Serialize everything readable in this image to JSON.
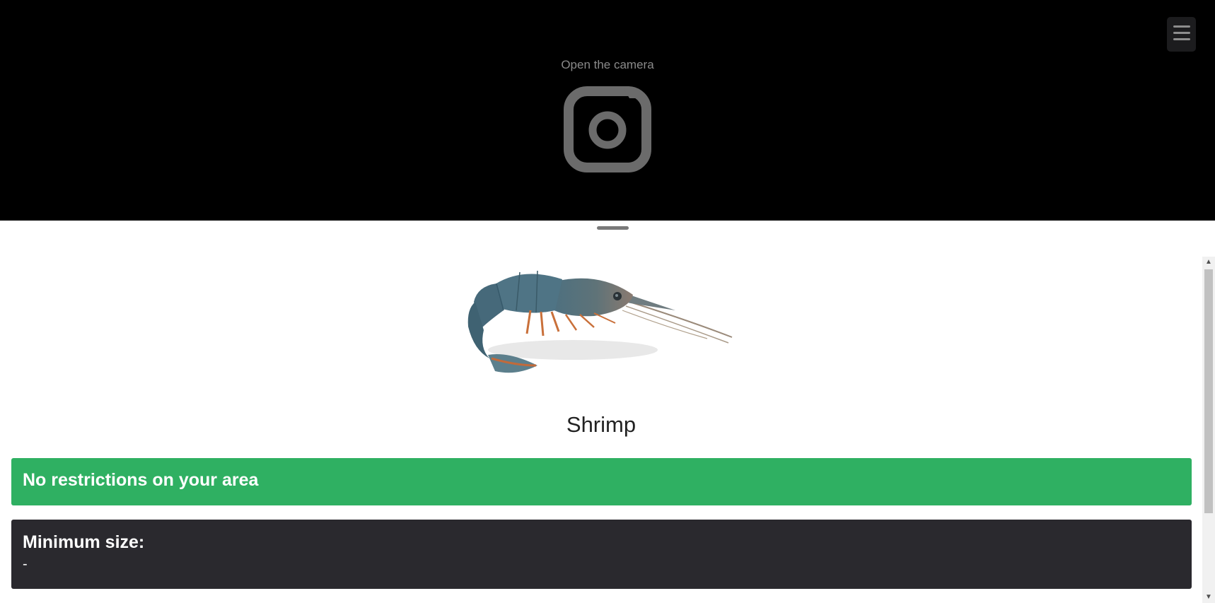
{
  "camera": {
    "label": "Open the camera",
    "icon": "camera-icon",
    "background_color": "#000000"
  },
  "menu": {
    "icon": "hamburger-menu-icon"
  },
  "species": {
    "name": "Shrimp",
    "image": "shrimp-illustration"
  },
  "status": {
    "text": "No restrictions on your area",
    "color": "#2fb062"
  },
  "minimum_size": {
    "title": "Minimum size:",
    "value": "-",
    "color": "#2a292e"
  }
}
